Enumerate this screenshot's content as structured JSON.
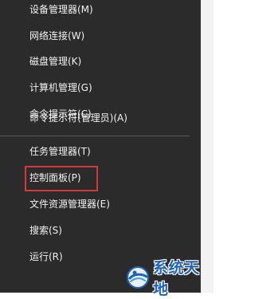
{
  "menu": {
    "items": [
      {
        "label": "设备管理器(M)"
      },
      {
        "label": "网络连接(W)"
      },
      {
        "label": "磁盘管理(K)"
      },
      {
        "label": "计算机管理(G)"
      },
      {
        "label": "命令提示符(C)"
      },
      {
        "label": "命令提示符(管理员)(A)"
      },
      {
        "label": "任务管理器(T)"
      },
      {
        "label": "控制面板(P)"
      },
      {
        "label": "文件资源管理器(E)"
      },
      {
        "label": "搜索(S)"
      },
      {
        "label": "运行(R)"
      }
    ]
  },
  "watermark": {
    "text": "系统天地",
    "logo_icon": "globe-logo-icon",
    "color": "#1f62b8"
  },
  "highlight_color": "#d23a3a",
  "menu_background": "#2b2b2b"
}
